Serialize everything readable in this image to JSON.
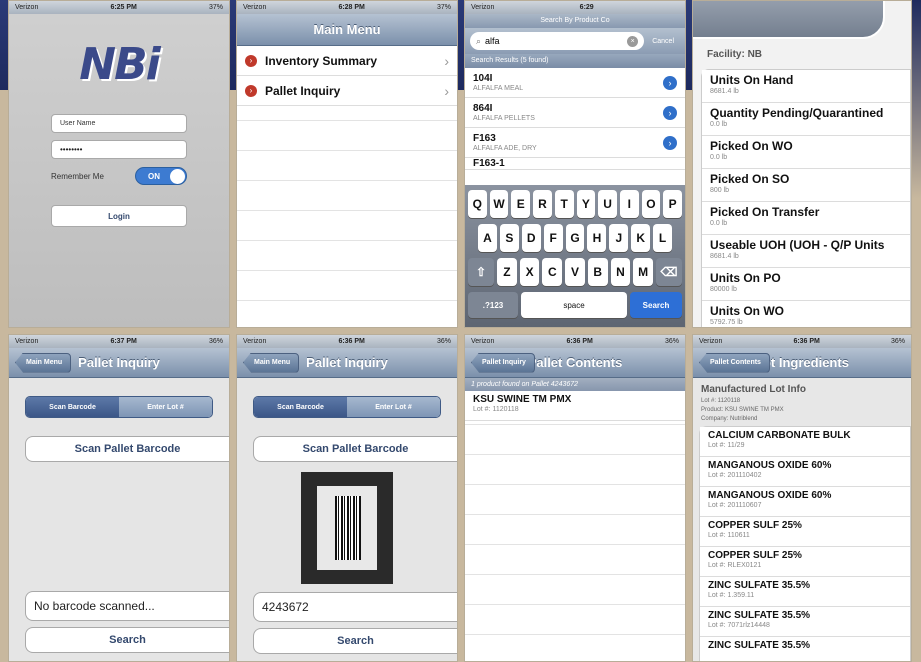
{
  "status": {
    "carrier": "Verizon",
    "times": [
      "6:25 PM",
      "6:28 PM",
      "6:29",
      "6:37 PM",
      "6:36 PM",
      "6:36 PM",
      "6:36 PM"
    ],
    "battery": [
      "37%",
      "37%",
      "36%",
      "36%",
      "36%",
      "36%"
    ]
  },
  "login": {
    "logo": "NBi",
    "username_placeholder": "User Name",
    "password_value": "••••••••",
    "remember_label": "Remember Me",
    "toggle_label": "ON",
    "login_label": "Login"
  },
  "menu": {
    "title": "Main Menu",
    "items": [
      {
        "label": "Inventory Summary"
      },
      {
        "label": "Pallet Inquiry"
      }
    ]
  },
  "search": {
    "header": "Search By Product Co",
    "query": "alfa",
    "cancel": "Cancel",
    "results_header": "Search Results (5 found)",
    "results": [
      {
        "code": "104I",
        "name": "ALFALFA MEAL"
      },
      {
        "code": "864I",
        "name": "ALFALFA PELLETS"
      },
      {
        "code": "F163",
        "name": "ALFALFA ADE, DRY"
      },
      {
        "code": "F163-1",
        "name": ""
      }
    ],
    "keys_row1": [
      "Q",
      "W",
      "E",
      "R",
      "T",
      "Y",
      "U",
      "I",
      "O",
      "P"
    ],
    "keys_row2": [
      "A",
      "S",
      "D",
      "F",
      "G",
      "H",
      "J",
      "K",
      "L"
    ],
    "keys_row3": [
      "Z",
      "X",
      "C",
      "V",
      "B",
      "N",
      "M"
    ],
    "key_123": ".?123",
    "key_space": "space",
    "key_search": "Search"
  },
  "summary": {
    "facility": "Facility: NB",
    "items": [
      {
        "label": "Units On Hand",
        "value": "8681.4 lb"
      },
      {
        "label": "Quantity Pending/Quarantined",
        "value": "0.0 lb"
      },
      {
        "label": "Picked On WO",
        "value": "0.0 lb"
      },
      {
        "label": "Picked On SO",
        "value": "800 lb"
      },
      {
        "label": "Picked On Transfer",
        "value": "0.0 lb"
      },
      {
        "label": "Useable UOH (UOH - Q/P Units",
        "value": "8681.4 lb"
      },
      {
        "label": "Units On PO",
        "value": "80000 lb"
      },
      {
        "label": "Units On WO",
        "value": "5792.75 lb"
      }
    ]
  },
  "pallet": {
    "back": "Main Menu",
    "title": "Pallet Inquiry",
    "seg_scan": "Scan Barcode",
    "seg_enter": "Enter Lot #",
    "scan_button": "Scan Pallet Barcode",
    "no_scan": "No barcode scanned...",
    "scanned_value": "4243672",
    "search": "Search"
  },
  "contents": {
    "back": "Pallet Inquiry",
    "title": "Pallet Contents",
    "header": "1 product found on Pallet 4243672",
    "items": [
      {
        "name": "KSU SWINE TM PMX",
        "lot": "Lot #: 1120118"
      }
    ]
  },
  "ingredients": {
    "back": "Pallet Contents",
    "title": "Lot Ingredients",
    "section": "Manufactured Lot Info",
    "lot": "Lot #: 1120118",
    "product": "Product: KSU SWINE TM PMX",
    "company": "Company: Nutriblend",
    "items": [
      {
        "name": "CALCIUM CARBONATE BULK",
        "lot": "Lot #: 11/29"
      },
      {
        "name": "MANGANOUS OXIDE 60%",
        "lot": "Lot #: 201110402"
      },
      {
        "name": "MANGANOUS OXIDE 60%",
        "lot": "Lot #: 201110607"
      },
      {
        "name": "COPPER SULF 25%",
        "lot": "Lot #: 110611"
      },
      {
        "name": "COPPER SULF 25%",
        "lot": "Lot #: RLEX0121"
      },
      {
        "name": "ZINC SULFATE 35.5%",
        "lot": "Lot #: 1.359.11"
      },
      {
        "name": "ZINC SULFATE 35.5%",
        "lot": "Lot #: 7071rlz14448"
      },
      {
        "name": "ZINC SULFATE 35.5%",
        "lot": ""
      }
    ]
  },
  "colors": {
    "nav": "#7b90ab",
    "accent": "#3b5687",
    "chevron": "#c0392b",
    "link": "#2f6fc9"
  }
}
